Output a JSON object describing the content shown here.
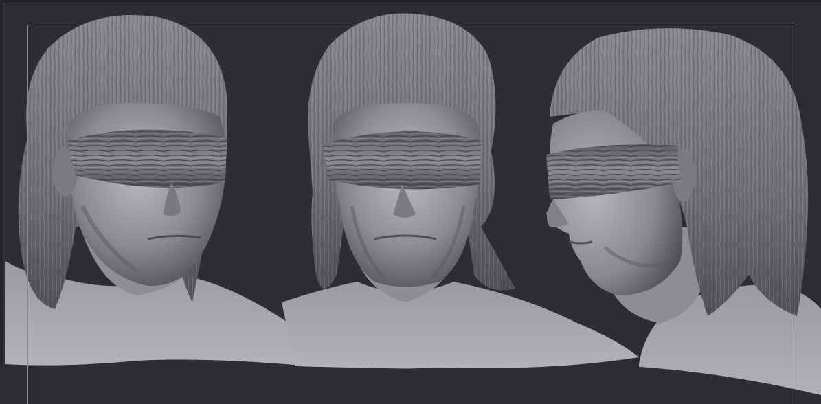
{
  "app": {
    "kind": "3d-sculpting-viewport"
  },
  "viewport": {
    "background_color": "#2f2d32",
    "frame_color": "#8a8890",
    "material_color": "#8f8e92"
  },
  "scene": {
    "views": [
      {
        "name": "three-quarter-left"
      },
      {
        "name": "front"
      },
      {
        "name": "profile-left"
      }
    ]
  }
}
